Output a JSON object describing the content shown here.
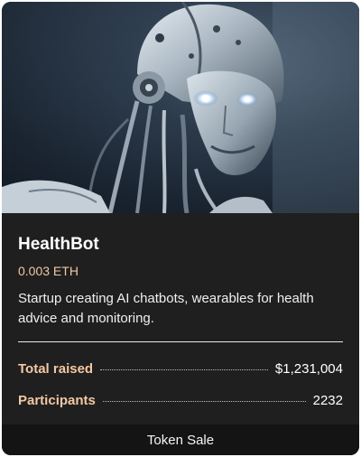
{
  "card": {
    "title": "HealthBot",
    "price": "0.003 ETH",
    "description": "Startup creating AI chatbots, wearables for health advice and monitoring.",
    "stats": [
      {
        "label": "Total raised",
        "value": "$1,231,004"
      },
      {
        "label": "Participants",
        "value": "2232"
      }
    ],
    "footer_label": "Token Sale"
  },
  "hero_image": {
    "icon": "robot-head-image"
  }
}
